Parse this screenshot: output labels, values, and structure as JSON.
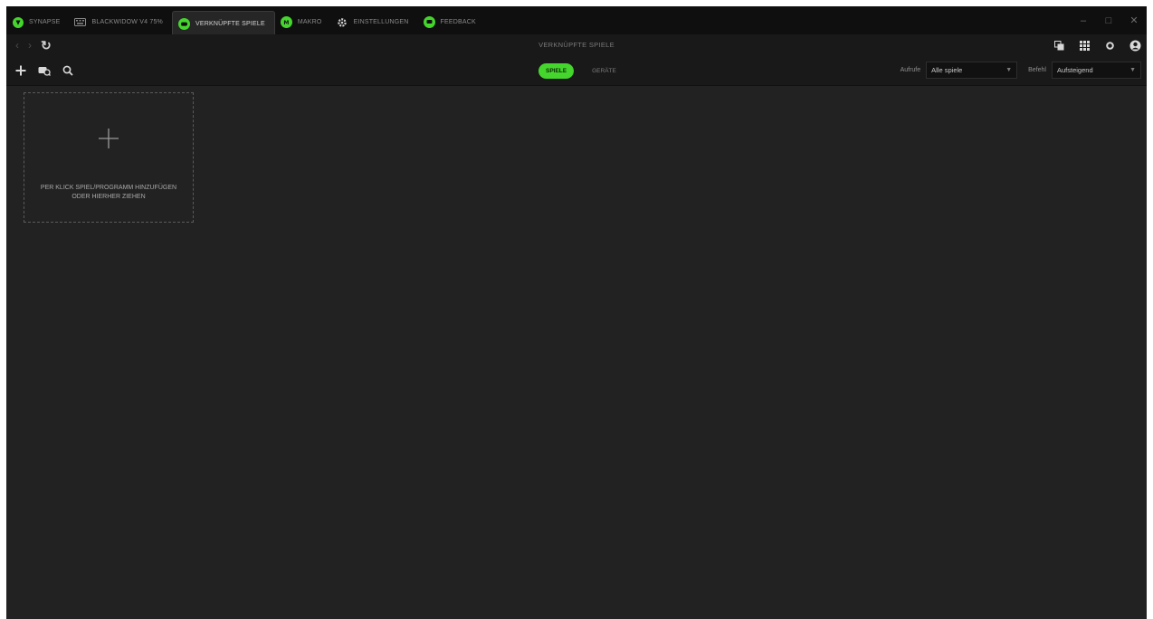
{
  "titlebar": {
    "tabs": [
      {
        "label": "SYNAPSE",
        "icon": "razer-logo-icon",
        "active": false
      },
      {
        "label": "BLACKWIDOW V4 75%",
        "icon": "keyboard-icon",
        "active": false
      },
      {
        "label": "VERKNÜPFTE SPIELE",
        "icon": "gamepad-icon",
        "active": true
      },
      {
        "label": "MAKRO",
        "icon": "macro-icon",
        "active": false
      },
      {
        "label": "EINSTELLUNGEN",
        "icon": "gear-icon",
        "active": false
      },
      {
        "label": "FEEDBACK",
        "icon": "feedback-icon",
        "active": false
      }
    ],
    "window_controls": {
      "minimize": "–",
      "maximize": "□",
      "close": "✕"
    }
  },
  "navbar": {
    "back": "‹",
    "forward": "›",
    "refresh": "↻",
    "title": "VERKNÜPFTE SPIELE"
  },
  "toolbar": {
    "segments": [
      {
        "label": "SPIELE",
        "active": true
      },
      {
        "label": "GERÄTE",
        "active": false
      }
    ],
    "filter": {
      "label": "Aufrufe",
      "value": "Alle spiele"
    },
    "sort": {
      "label": "Befehl",
      "value": "Aufsteigend"
    }
  },
  "content": {
    "add_card_hint": "PER KLICK SPIEL/PROGRAMM HINZUFÜGEN ODER HIERHER ZIEHEN"
  },
  "colors": {
    "accent": "#44d62c",
    "background": "#222222",
    "titlebar": "#0f0f0f",
    "bar": "#191919"
  }
}
